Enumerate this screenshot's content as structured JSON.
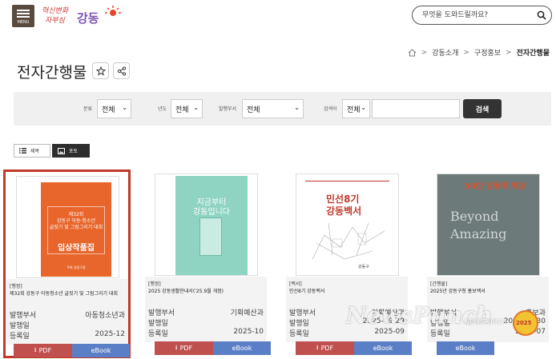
{
  "header": {
    "menu_label": "MENU",
    "logo_line1": "혁신변화",
    "logo_line2": "자부심",
    "logo_brand": "강동",
    "search_placeholder": "무엇을 도와드릴까요?"
  },
  "breadcrumb": [
    "강동소개",
    "구정홍보",
    "전자간행물"
  ],
  "page_title": "전자간행물",
  "filters": {
    "category_label": "분류",
    "category_value": "전체",
    "year_label": "년도",
    "year_value": "전체",
    "dept_label": "발행부서",
    "dept_value": "전체",
    "keyword_label": "검색어",
    "keyword_value": "전체",
    "search_button": "검색"
  },
  "view_toggle": {
    "list": "제목",
    "photo": "포토"
  },
  "labels": {
    "dept": "발행부서",
    "issued": "발행일",
    "registered": "등록일",
    "pdf": "PDF",
    "ebook": "eBook"
  },
  "cards": [
    {
      "category": "[행정]",
      "title": "제32회 강동구 아동청소년 글짓기 및 그림그리기 대회",
      "dept": "아동청소년과",
      "issued": "",
      "registered": "2025-12",
      "cover": {
        "line1": "제32회",
        "line2": "강동구 아동·청소년",
        "line3": "글짓기 및 그림그리기 대회",
        "main": "입상작품집",
        "footer": "주최 강동구청"
      }
    },
    {
      "category": "[행정]",
      "title": "2025 강동생활안내서('25.9월 개정)",
      "dept": "기획예산과",
      "issued": "",
      "registered": "2025-10",
      "cover": {
        "line1": "지금부터",
        "line2": "강동입니다"
      }
    },
    {
      "category": "[백서]",
      "title": "민선8기 강동백서",
      "dept": "기획예산과",
      "issued": "2025-09-29",
      "registered": "2025-09",
      "cover": {
        "line1": "민선8기",
        "line2": "강동백서",
        "footer": "강동구"
      }
    },
    {
      "category": "[간행물]",
      "title": "2025년 강동구청 홍보백서",
      "dept": "홍보과",
      "issued": "2025-08-30",
      "registered": "2025-07",
      "cover": {
        "line1": "50만 강동의 위상",
        "line2": "Beyond",
        "line3": "Amazing"
      }
    }
  ],
  "watermark": {
    "main": "NewsPunch",
    "small": "NEWSPUNCH",
    "badge": "2025"
  }
}
